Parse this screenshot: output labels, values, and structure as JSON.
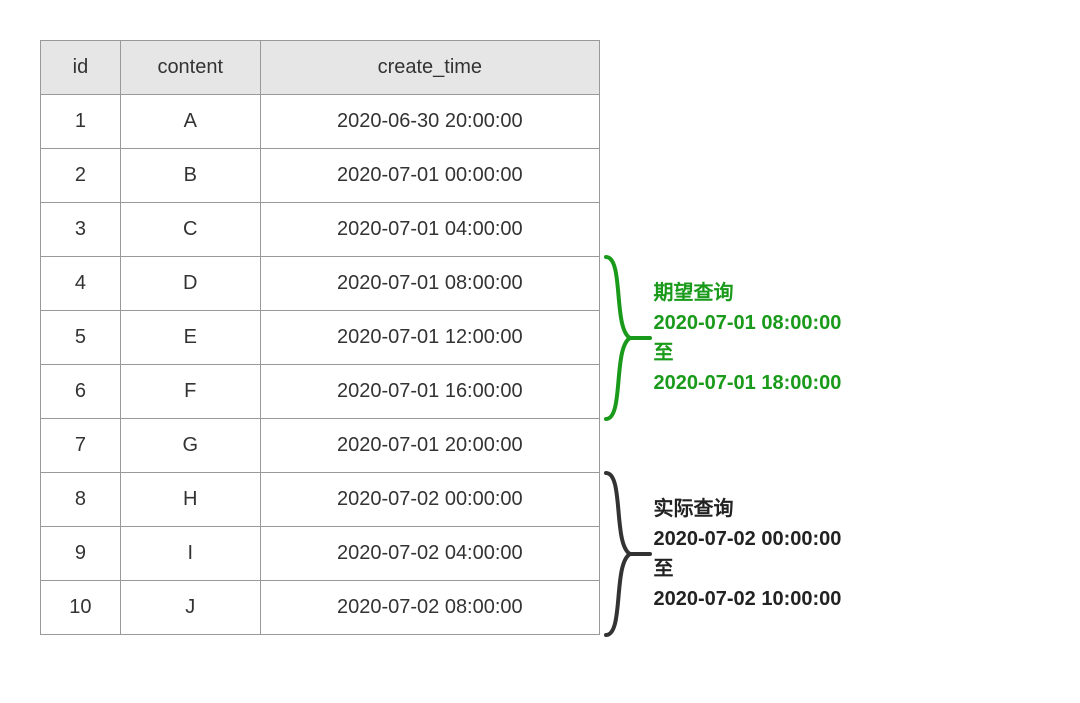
{
  "table": {
    "headers": {
      "id": "id",
      "content": "content",
      "time": "create_time"
    },
    "rows": [
      {
        "id": "1",
        "content": "A",
        "time": "2020-06-30 20:00:00"
      },
      {
        "id": "2",
        "content": "B",
        "time": "2020-07-01 00:00:00"
      },
      {
        "id": "3",
        "content": "C",
        "time": "2020-07-01 04:00:00"
      },
      {
        "id": "4",
        "content": "D",
        "time": "2020-07-01 08:00:00"
      },
      {
        "id": "5",
        "content": "E",
        "time": "2020-07-01 12:00:00"
      },
      {
        "id": "6",
        "content": "F",
        "time": "2020-07-01 16:00:00"
      },
      {
        "id": "7",
        "content": "G",
        "time": "2020-07-01 20:00:00"
      },
      {
        "id": "8",
        "content": "H",
        "time": "2020-07-02 00:00:00"
      },
      {
        "id": "9",
        "content": "I",
        "time": "2020-07-02 04:00:00"
      },
      {
        "id": "10",
        "content": "J",
        "time": "2020-07-02 08:00:00"
      }
    ]
  },
  "annotations": {
    "expected": {
      "title": "期望查询",
      "from": "2020-07-01 08:00:00",
      "to_label": "至",
      "to": "2020-07-01 18:00:00",
      "color": "#1a9a1a",
      "rows_start_index": 3,
      "rows_end_index": 5
    },
    "actual": {
      "title": "实际查询",
      "from": "2020-07-02 00:00:00",
      "to_label": "至",
      "to": "2020-07-02 10:00:00",
      "color": "#222",
      "rows_start_index": 7,
      "rows_end_index": 9
    }
  }
}
